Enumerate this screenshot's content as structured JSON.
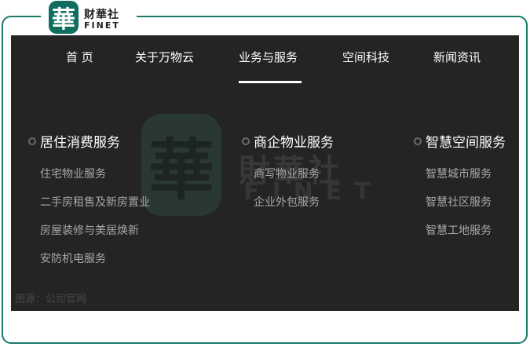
{
  "logo": {
    "seal_char": "華",
    "name_cn": "财華社",
    "name_en": "FINET"
  },
  "nav": {
    "items": [
      {
        "label": "首 页"
      },
      {
        "label": "关于万物云"
      },
      {
        "label": "业务与服务",
        "active": true
      },
      {
        "label": "空间科技"
      },
      {
        "label": "新闻资讯"
      }
    ]
  },
  "columns": [
    {
      "title": "居住消费服务",
      "items": [
        "住宅物业服务",
        "二手房租售及新房置业",
        "房屋装修与美居焕新",
        "安防机电服务"
      ]
    },
    {
      "title": "商企物业服务",
      "items": [
        "商写物业服务",
        "企业外包服务"
      ]
    },
    {
      "title": "智慧空间服务",
      "items": [
        "智慧城市服务",
        "智慧社区服务",
        "智慧工地服务"
      ]
    }
  ],
  "watermark": {
    "seal_char": "華",
    "name_cn": "財華社",
    "name_en": "FINET"
  },
  "caption": "图源：公司官网",
  "colors": {
    "frame_border": "#1a7a6a",
    "logo_green": "#0f6e5e",
    "panel_bg": "#242424",
    "nav_text": "#ffffff",
    "sub_item_text": "#a8a8a8"
  }
}
